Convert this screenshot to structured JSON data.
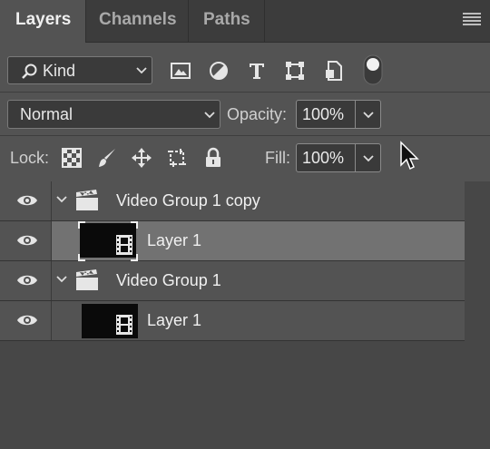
{
  "tabs": [
    {
      "label": "Layers",
      "active": true
    },
    {
      "label": "Channels",
      "active": false
    },
    {
      "label": "Paths",
      "active": false
    }
  ],
  "filter": {
    "kind_label": "Kind",
    "icons": [
      "image-filter-icon",
      "adjustment-filter-icon",
      "type-filter-icon",
      "shape-filter-icon",
      "smart-object-filter-icon",
      "filter-toggle-icon"
    ]
  },
  "blend": {
    "mode": "Normal",
    "opacity_label": "Opacity:",
    "opacity_value": "100%"
  },
  "lock": {
    "label": "Lock:",
    "icons": [
      "lock-transparent-pixels-icon",
      "lock-image-pixels-icon",
      "lock-position-icon",
      "lock-artboard-icon",
      "lock-all-icon"
    ],
    "fill_label": "Fill:",
    "fill_value": "100%"
  },
  "layers": [
    {
      "type": "group",
      "name": "Video Group 1 copy",
      "visible": true,
      "expanded": true,
      "selected": false
    },
    {
      "type": "video",
      "name": "Layer 1",
      "visible": true,
      "selected": true
    },
    {
      "type": "group",
      "name": "Video Group 1",
      "visible": true,
      "expanded": true,
      "selected": false
    },
    {
      "type": "video",
      "name": "Layer 1",
      "visible": true,
      "selected": false
    }
  ],
  "colors": {
    "panel_bg": "#535353",
    "tabbar_bg": "#3c3c3c",
    "selected_row": "#727272",
    "text": "#f0f0f0"
  }
}
